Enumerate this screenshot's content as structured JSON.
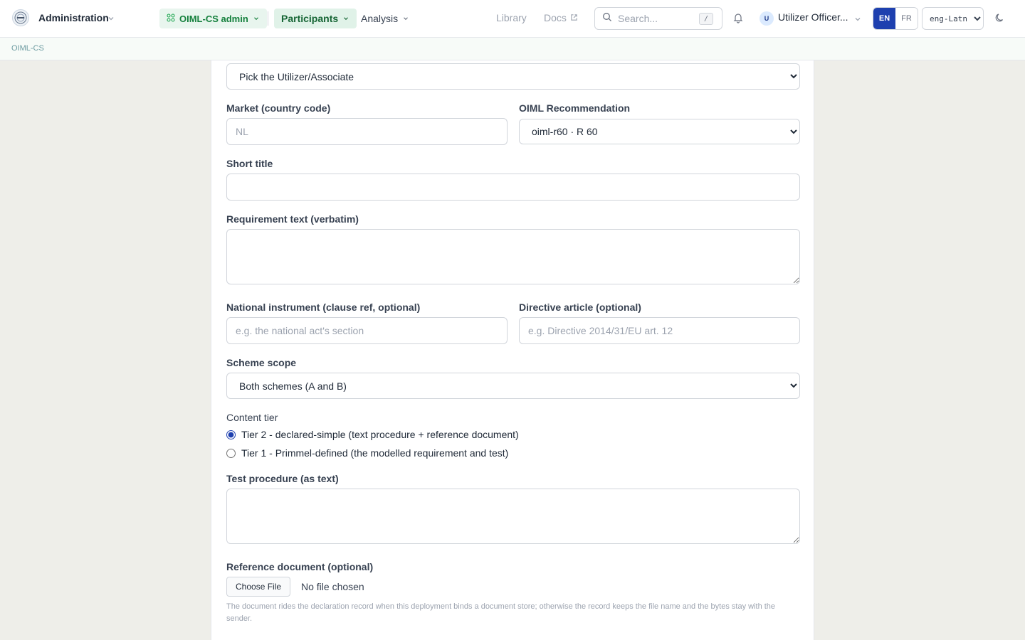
{
  "header": {
    "app_title": "Administration",
    "nav": {
      "admin_label": "OIML-CS admin",
      "participants_label": "Participants",
      "analysis_label": "Analysis",
      "library_label": "Library",
      "docs_label": "Docs"
    },
    "search": {
      "placeholder": "Search...",
      "shortcut": "/"
    },
    "user": {
      "initial": "U",
      "name": "Utilizer Officer..."
    },
    "lang": {
      "en": "EN",
      "fr": "FR"
    },
    "script": {
      "selected": "eng-Latn"
    }
  },
  "breadcrumb": {
    "label": "OIML-CS"
  },
  "form": {
    "utilizer_select": {
      "selected": "Pick the Utilizer/Associate"
    },
    "market": {
      "label": "Market (country code)",
      "placeholder": "NL"
    },
    "recommendation": {
      "label": "OIML Recommendation",
      "selected": "oiml-r60 · R 60"
    },
    "short_title": {
      "label": "Short title",
      "value": ""
    },
    "requirement_text": {
      "label": "Requirement text (verbatim)",
      "value": ""
    },
    "national_instrument": {
      "label": "National instrument (clause ref, optional)",
      "placeholder": "e.g. the national act's section"
    },
    "directive_article": {
      "label": "Directive article (optional)",
      "placeholder": "e.g. Directive 2014/31/EU art. 12"
    },
    "scheme_scope": {
      "label": "Scheme scope",
      "selected": "Both schemes (A and B)"
    },
    "content_tier": {
      "label": "Content tier",
      "options": [
        {
          "label": "Tier 2 - declared-simple (text procedure + reference document)",
          "checked": true
        },
        {
          "label": "Tier 1 - Primmel-defined (the modelled requirement and test)",
          "checked": false
        }
      ]
    },
    "test_procedure": {
      "label": "Test procedure (as text)",
      "value": ""
    },
    "reference_document": {
      "label": "Reference document (optional)",
      "button_label": "Choose File",
      "status": "No file chosen",
      "help": "The document rides the declaration record when this deployment binds a document store; otherwise the record keeps the file name and the bytes stay with the sender."
    }
  }
}
